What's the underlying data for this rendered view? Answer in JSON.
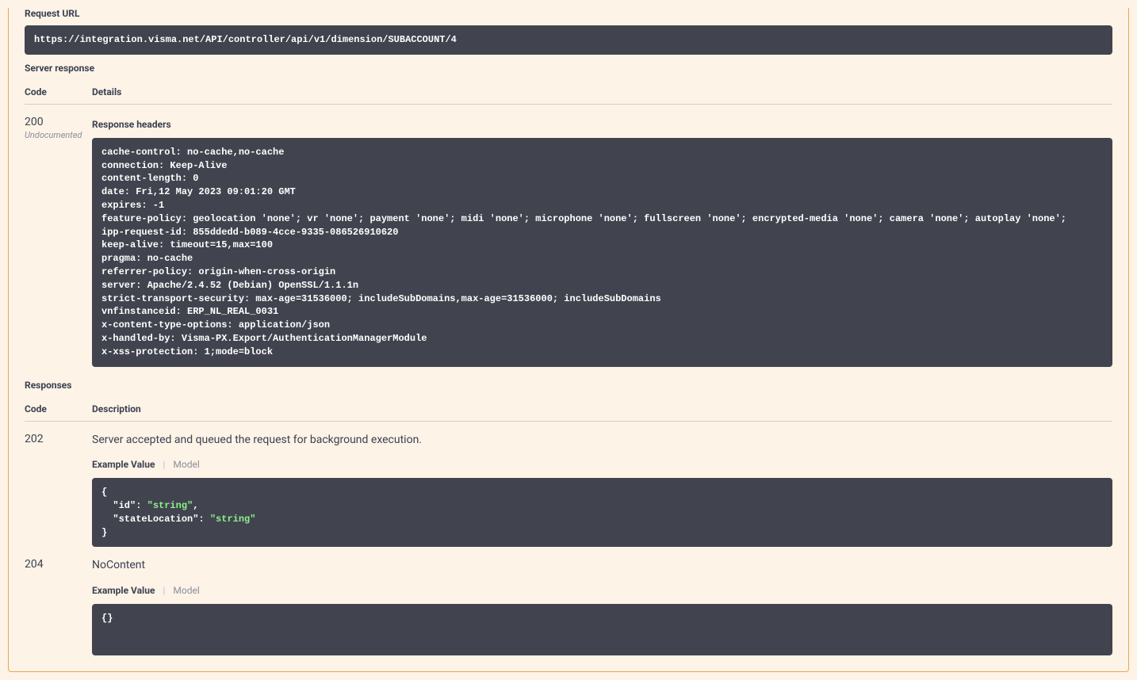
{
  "labels": {
    "request_url": "Request URL",
    "server_response": "Server response",
    "code": "Code",
    "details": "Details",
    "response_headers": "Response headers",
    "responses": "Responses",
    "description": "Description",
    "example_value": "Example Value",
    "model": "Model",
    "undocumented": "Undocumented"
  },
  "request_url": "https://integration.visma.net/API/controller/api/v1/dimension/SUBACCOUNT/4",
  "server_response": {
    "code": "200",
    "headers_text": "cache-control: no-cache,no-cache\nconnection: Keep-Alive\ncontent-length: 0\ndate: Fri,12 May 2023 09:01:20 GMT\nexpires: -1\nfeature-policy: geolocation 'none'; vr 'none'; payment 'none'; midi 'none'; microphone 'none'; fullscreen 'none'; encrypted-media 'none'; camera 'none'; autoplay 'none';\nipp-request-id: 855ddedd-b089-4cce-9335-086526910620\nkeep-alive: timeout=15,max=100\npragma: no-cache\nreferrer-policy: origin-when-cross-origin\nserver: Apache/2.4.52 (Debian) OpenSSL/1.1.1n\nstrict-transport-security: max-age=31536000; includeSubDomains,max-age=31536000; includeSubDomains\nvnfinstanceid: ERP_NL_REAL_0031\nx-content-type-options: application/json\nx-handled-by: Visma-PX.Export/AuthenticationManagerModule\nx-xss-protection: 1;mode=block"
  },
  "responses": [
    {
      "code": "202",
      "description": "Server accepted and queued the request for background execution.",
      "example": {
        "id": "string",
        "stateLocation": "string"
      }
    },
    {
      "code": "204",
      "description": "NoContent",
      "example": {}
    }
  ]
}
